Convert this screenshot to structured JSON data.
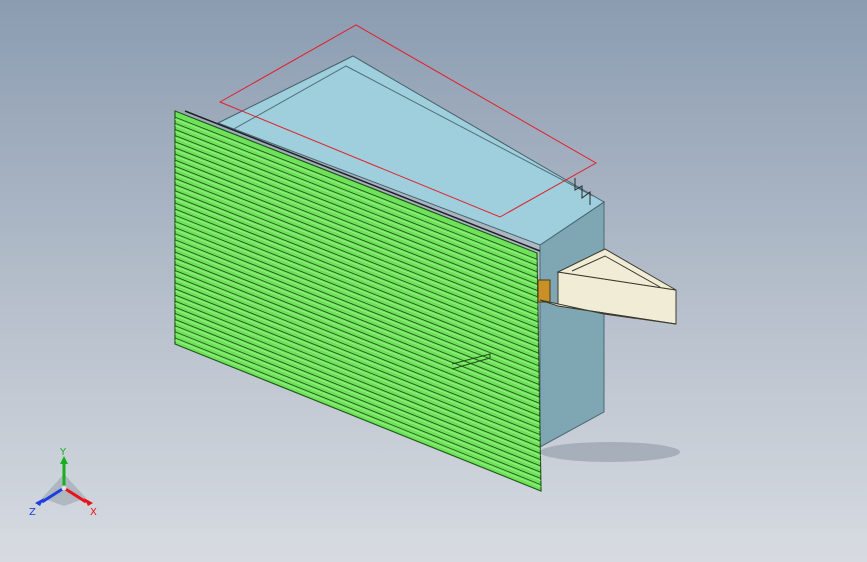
{
  "viewport": {
    "background_top": "#8b9cb1",
    "background_bottom": "#d7dbe1"
  },
  "model": {
    "louver_color": "#6ee35a",
    "louver_line_color": "#1f5a18",
    "box_top_color": "#9fcfdc",
    "box_side_color": "#7fa7b3",
    "bracket_color": "#f0ecd6",
    "sketch_color": "#e0202a",
    "louver_count": 38
  },
  "triad": {
    "x_label": "X",
    "y_label": "Y",
    "z_label": "Z",
    "x_color": "#e8121a",
    "y_color": "#16b01f",
    "z_color": "#1f3ee0"
  }
}
